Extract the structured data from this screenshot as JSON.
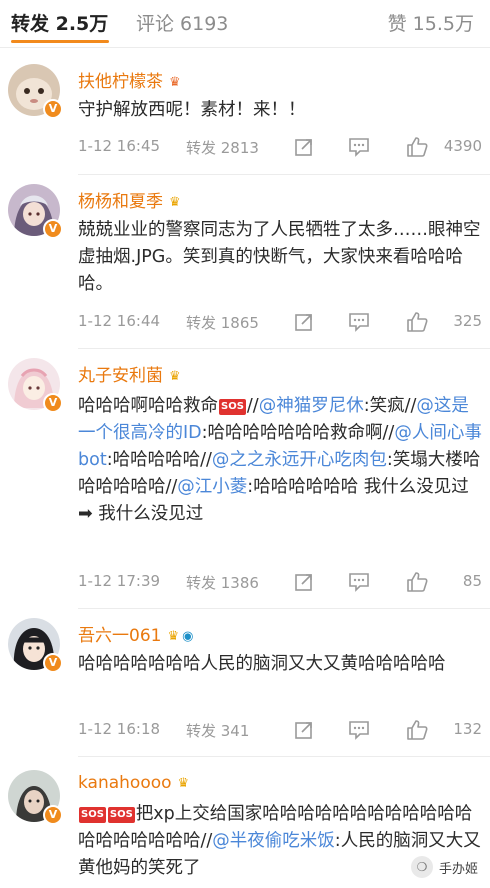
{
  "tabs": {
    "reposts": "转发 2.5万",
    "comments": "评论 6193",
    "likes": "赞 15.5万"
  },
  "comments": [
    {
      "username": "扶他柠檬茶",
      "text_parts": [
        "守护解放西呢！素材！来！！"
      ],
      "time": "1-12 16:45",
      "repost": "转发 2813",
      "likes": "4390"
    },
    {
      "username": "杨杨和夏季",
      "text_parts": [
        "兢兢业业的警察同志为了人民牺牲了太多……眼神空虚抽烟.JPG。笑到真的快断气，大家快来看哈哈哈哈。"
      ],
      "time": "1-12 16:44",
      "repost": "转发 1865",
      "likes": "325"
    },
    {
      "username": "丸子安利菌",
      "text_parts": [
        "哈哈哈啊哈哈救命",
        "SOS",
        "//",
        "@神猫罗尼休",
        ":笑疯//",
        "@这是一个很高冷的ID",
        ":哈哈哈哈哈哈哈救命啊//",
        "@人间心事bot",
        ":哈哈哈哈哈//",
        "@之之永远开心吃肉包",
        ":笑塌大楼哈哈哈哈哈哈//",
        "@江小菱",
        ":哈哈哈哈哈哈 我什么没见过 ➡ 我什么没见过"
      ],
      "time": "1-12 17:39",
      "repost": "转发 1386",
      "likes": "85"
    },
    {
      "username": "吾六一061",
      "text_parts": [
        "哈哈哈哈哈哈哈人民的脑洞又大又黄哈哈哈哈哈"
      ],
      "time": "1-12 16:18",
      "repost": "转发 341",
      "likes": "132"
    },
    {
      "username": "kanahoooo",
      "text_parts": [
        "SOS",
        "SOS",
        "把xp上交给国家哈哈哈哈哈哈哈哈哈哈哈哈哈哈哈哈哈哈哈//",
        "@半夜偷吃米饭",
        ":人民的脑洞又大又黄他妈的笑死了"
      ]
    }
  ],
  "watermark": "手办姬",
  "colors": {
    "accent": "#f28a1c",
    "username": "#e9790f",
    "mention": "#4b87d8",
    "meta": "#9a9a9a"
  },
  "icons": [
    "v-badge-icon",
    "crown-icon",
    "globe-icon",
    "share-icon",
    "comment-icon",
    "like-icon",
    "sos-icon"
  ]
}
